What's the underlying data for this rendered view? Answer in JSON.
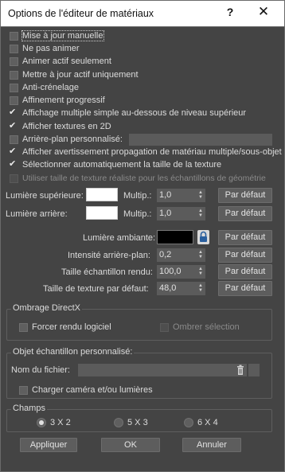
{
  "window": {
    "title": "Options de l'éditeur de matériaux",
    "help_glyph": "?",
    "close_glyph": "✕"
  },
  "checkboxes": [
    {
      "label": "Mise à jour manuelle",
      "checked": false
    },
    {
      "label": "Ne pas animer",
      "checked": false
    },
    {
      "label": "Animer actif seulement",
      "checked": false
    },
    {
      "label": "Mettre à jour actif uniquement",
      "checked": false
    },
    {
      "label": "Anti-crénelage",
      "checked": false
    },
    {
      "label": "Affinement progressif",
      "checked": false
    },
    {
      "label": "Affichage multiple simple au-dessous de niveau supérieur",
      "checked": true
    },
    {
      "label": "Afficher textures en 2D",
      "checked": true
    },
    {
      "label": "Arrière-plan personnalisé:",
      "checked": false
    },
    {
      "label": "Afficher avertissement propagation de matériau multiple/sous-objet",
      "checked": true
    },
    {
      "label": "Sélectionner automatiquement la taille de la texture",
      "checked": true
    },
    {
      "label": "Utiliser taille de texture réaliste pour les échantillons de géométrie",
      "checked": false,
      "disabled": true
    }
  ],
  "lights": {
    "top_label": "Lumière supérieure:",
    "back_label": "Lumière arrière:",
    "multiplier_label": "Multip.:",
    "top_multiplier": "1,0",
    "back_multiplier": "1,0",
    "top_color": "#ffffff",
    "back_color": "#ffffff"
  },
  "default_button": "Par défaut",
  "ambient": {
    "label": "Lumière ambiante:",
    "color": "#000000",
    "lock_icon": "lock-icon"
  },
  "background_intensity": {
    "label": "Intensité arrière-plan:",
    "value": "0,2"
  },
  "sample_size": {
    "label": "Taille échantillon rendu:",
    "value": "100,0"
  },
  "default_texture_size": {
    "label": "Taille de texture par défaut:",
    "value": "48,0"
  },
  "directx": {
    "title": "Ombrage DirectX",
    "force_software": "Forcer rendu logiciel",
    "shade_selection": "Ombrer sélection"
  },
  "custom_sample": {
    "title": "Objet échantillon personnalisé:",
    "file_label": "Nom du fichier:",
    "file_value": "",
    "load_camera": "Charger caméra et/ou lumières"
  },
  "slots": {
    "title": "Champs",
    "options": [
      "3 X 2",
      "5 X 3",
      "6 X 4"
    ],
    "selected": "3 X 2"
  },
  "footer": {
    "apply": "Appliquer",
    "ok": "OK",
    "cancel": "Annuler"
  }
}
